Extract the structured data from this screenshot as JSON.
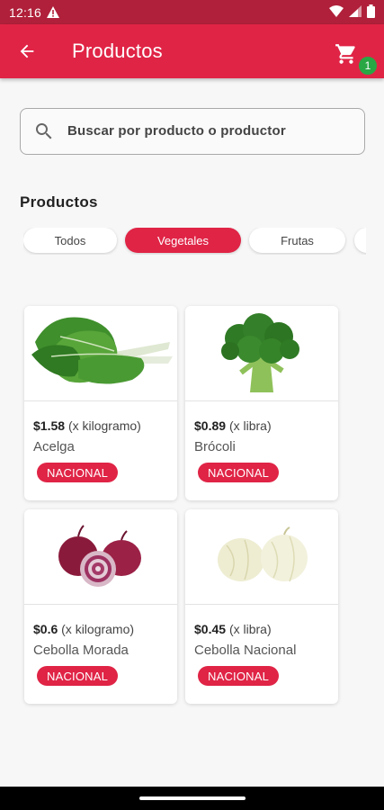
{
  "status_bar": {
    "time": "12:16"
  },
  "app_bar": {
    "title": "Productos",
    "cart_count": "1"
  },
  "search": {
    "placeholder": "Buscar por producto o productor"
  },
  "section": {
    "title": "Productos"
  },
  "categories": [
    {
      "label": "Todos",
      "active": false
    },
    {
      "label": "Vegetales",
      "active": true
    },
    {
      "label": "Frutas",
      "active": false
    }
  ],
  "products": [
    {
      "price": "$1.58",
      "unit": "(x kilogramo)",
      "name": "Acelga",
      "badge": "NACIONAL",
      "image": "chard-image"
    },
    {
      "price": "$0.89",
      "unit": "(x libra)",
      "name": "Brócoli",
      "badge": "NACIONAL",
      "image": "broccoli-image"
    },
    {
      "price": "$0.6",
      "unit": "(x kilogramo)",
      "name": "Cebolla Morada",
      "badge": "NACIONAL",
      "image": "red-onion-image"
    },
    {
      "price": "$0.45",
      "unit": "(x libra)",
      "name": "Cebolla Nacional",
      "badge": "NACIONAL",
      "image": "white-onion-image"
    }
  ],
  "colors": {
    "primary": "#e02446",
    "status_bar": "#b0203a",
    "badge_green": "#29a745"
  }
}
